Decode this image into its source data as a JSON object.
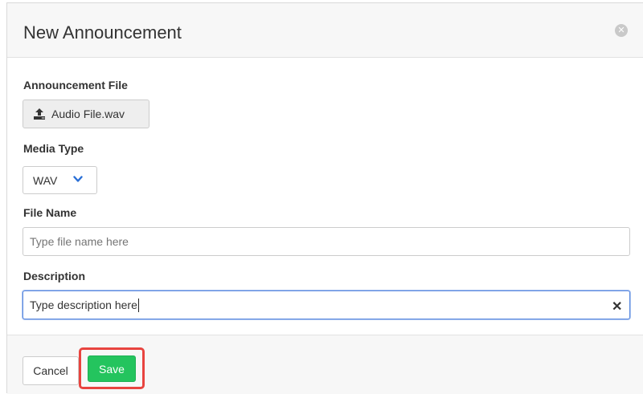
{
  "dialog": {
    "title": "New Announcement",
    "close_icon": "close-circle-icon"
  },
  "form": {
    "announcement_file": {
      "label": "Announcement File",
      "button_label": "Audio File.wav",
      "icon": "upload-icon"
    },
    "media_type": {
      "label": "Media Type",
      "selected": "WAV",
      "icon": "chevron-down-icon"
    },
    "file_name": {
      "label": "File Name",
      "value": "",
      "placeholder": "Type file name here"
    },
    "description": {
      "label": "Description",
      "value": "Type description here",
      "clear_glyph": "✕"
    }
  },
  "footer": {
    "cancel_label": "Cancel",
    "save_label": "Save"
  },
  "colors": {
    "save_button": "#24c45e",
    "highlight": "#e8443f",
    "focus_border": "#5b8ae0",
    "chevron": "#2a6fd6"
  }
}
